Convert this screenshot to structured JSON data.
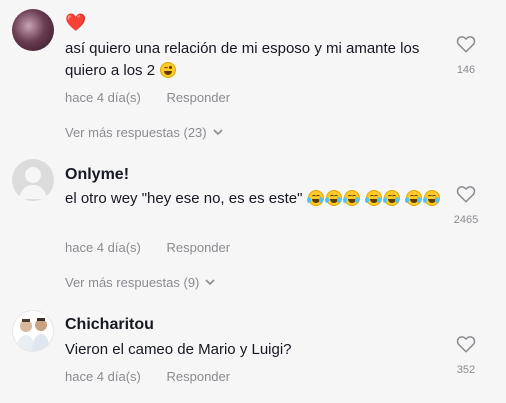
{
  "comments": [
    {
      "username": "",
      "username_emoji": "❤️",
      "text": "así quiero una relación de mi esposo y mi amante los quiero a los 2",
      "text_emojis": [
        "wink-face"
      ],
      "time": "hace 4 día(s)",
      "reply_label": "Responder",
      "likes": "146",
      "more_replies": "Ver más respuestas (23)"
    },
    {
      "username": "Onlyme!",
      "text": "el otro wey \"hey ese no, es es este\"",
      "text_emojis": [
        "laughing-tears-face",
        "laughing-tears-face",
        "laughing-tears-face",
        "laughing-tears-face",
        "laughing-tears-face",
        "laughing-tears-face",
        "laughing-tears-face"
      ],
      "time": "hace 4 día(s)",
      "reply_label": "Responder",
      "likes": "2465",
      "more_replies": "Ver más respuestas (9)"
    },
    {
      "username": "Chicharitou",
      "text": "Vieron el cameo de Mario y Luigi?",
      "time": "hace 4 día(s)",
      "reply_label": "Responder",
      "likes": "352"
    }
  ],
  "colors": {
    "background": "#f6f6f6",
    "text": "#161823",
    "muted": "#8a8b91",
    "heart": "#fe2c55"
  }
}
